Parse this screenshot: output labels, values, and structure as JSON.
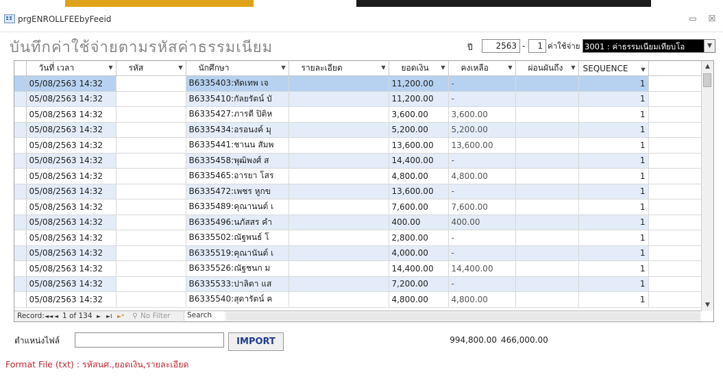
{
  "window": {
    "title": "prgENROLLFEEbyFeeid",
    "minimize": "▭",
    "close": "☒"
  },
  "header": {
    "title": "บันทึกค่าใช้จ่ายตามรหัสค่าธรรมเนียม",
    "year_label": "ปี",
    "year_value": "2563",
    "dash": "-",
    "term_value": "1",
    "expense_label": "ค่าใช้จ่าย",
    "expense_selected": "3001 : ค่าธรรมเนียมเทียบโอ"
  },
  "table": {
    "columns": [
      {
        "label": "วันที่ เวลา"
      },
      {
        "label": "รหัส"
      },
      {
        "label": "นักศึกษา"
      },
      {
        "label": "รายละเอียด"
      },
      {
        "label": "ยอดเงิน"
      },
      {
        "label": "คงเหลือ"
      },
      {
        "label": "ผ่อนผันถึง"
      },
      {
        "label": "SEQUENCE"
      }
    ],
    "rows": [
      {
        "date": "05/08/2563 14:32",
        "code": "",
        "student": "B6335403:ทัดเทพ เจ",
        "detail": "",
        "amount": "11,200.00",
        "remain": "-",
        "defer": "",
        "seq": "1"
      },
      {
        "date": "05/08/2563 14:32",
        "code": "",
        "student": "B6335410:กัลยรัตน์ บั",
        "detail": "",
        "amount": "11,200.00",
        "remain": "-",
        "defer": "",
        "seq": "1"
      },
      {
        "date": "05/08/2563 14:32",
        "code": "",
        "student": "B6335427:ภารดี ปิติห",
        "detail": "",
        "amount": "3,600.00",
        "remain": "3,600.00",
        "defer": "",
        "seq": "1"
      },
      {
        "date": "05/08/2563 14:32",
        "code": "",
        "student": "B6335434:อรอนงค์ มุ",
        "detail": "",
        "amount": "5,200.00",
        "remain": "5,200.00",
        "defer": "",
        "seq": "1"
      },
      {
        "date": "05/08/2563 14:32",
        "code": "",
        "student": "B6335441:ชานน สัมพ",
        "detail": "",
        "amount": "13,600.00",
        "remain": "13,600.00",
        "defer": "",
        "seq": "1"
      },
      {
        "date": "05/08/2563 14:32",
        "code": "",
        "student": "B6335458:พุฒิพงศ์ ส",
        "detail": "",
        "amount": "14,400.00",
        "remain": "-",
        "defer": "",
        "seq": "1"
      },
      {
        "date": "05/08/2563 14:32",
        "code": "",
        "student": "B6335465:อารยา โสร",
        "detail": "",
        "amount": "4,800.00",
        "remain": "4,800.00",
        "defer": "",
        "seq": "1"
      },
      {
        "date": "05/08/2563 14:32",
        "code": "",
        "student": "B6335472:เพชร หูกข",
        "detail": "",
        "amount": "13,600.00",
        "remain": "-",
        "defer": "",
        "seq": "1"
      },
      {
        "date": "05/08/2563 14:32",
        "code": "",
        "student": "B6335489:คุณานนต์ เ",
        "detail": "",
        "amount": "7,600.00",
        "remain": "7,600.00",
        "defer": "",
        "seq": "1"
      },
      {
        "date": "05/08/2563 14:32",
        "code": "",
        "student": "B6335496:นภัสสร คำ",
        "detail": "",
        "amount": "400.00",
        "remain": "400.00",
        "defer": "",
        "seq": "1"
      },
      {
        "date": "05/08/2563 14:32",
        "code": "",
        "student": "B6335502:ณัฐพนธ์ โ",
        "detail": "",
        "amount": "2,800.00",
        "remain": "-",
        "defer": "",
        "seq": "1"
      },
      {
        "date": "05/08/2563 14:32",
        "code": "",
        "student": "B6335519:คุณานันต์ เ",
        "detail": "",
        "amount": "4,000.00",
        "remain": "-",
        "defer": "",
        "seq": "1"
      },
      {
        "date": "05/08/2563 14:32",
        "code": "",
        "student": "B6335526:ณัฐชนก ม",
        "detail": "",
        "amount": "14,400.00",
        "remain": "14,400.00",
        "defer": "",
        "seq": "1"
      },
      {
        "date": "05/08/2563 14:32",
        "code": "",
        "student": "B6335533:ปาลิตา แส",
        "detail": "",
        "amount": "7,200.00",
        "remain": "-",
        "defer": "",
        "seq": "1"
      },
      {
        "date": "05/08/2563 14:32",
        "code": "",
        "student": "B6335540:สุดารัตน์ ค",
        "detail": "",
        "amount": "4,800.00",
        "remain": "4,800.00",
        "defer": "",
        "seq": "1"
      }
    ]
  },
  "navbar": {
    "record_label": "Record:",
    "first": "◄◄",
    "prev": "◄",
    "position": "1 of 134",
    "next": "►",
    "last": "►I",
    "new": "►*",
    "filter": "No Filter",
    "search": "Search"
  },
  "footer": {
    "path_label": "ตำแหน่งไฟล์",
    "path_value": "",
    "import_label": "IMPORT",
    "total_amount": "994,800.00",
    "total_remain": "466,000.00",
    "format_note": "Format File (txt)  : รหัสนศ.,ยอดเงิน,รายละเอียด"
  }
}
